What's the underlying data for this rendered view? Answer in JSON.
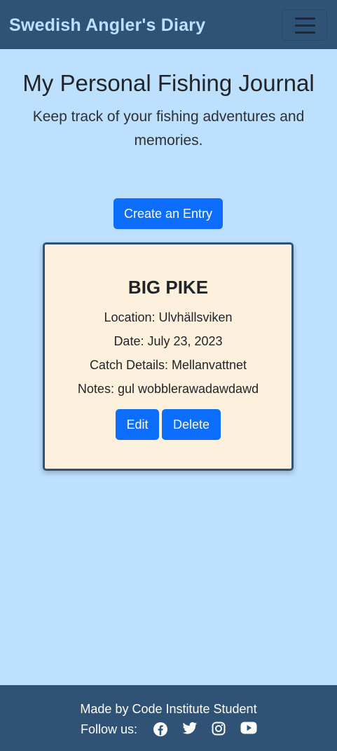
{
  "navbar": {
    "brand": "Swedish Angler's Diary",
    "toggler_icon": "hamburger-menu-icon"
  },
  "header": {
    "title": "My Personal Fishing Journal",
    "subtitle": "Keep track of your fishing adventures and memories."
  },
  "actions": {
    "create_label": "Create an Entry"
  },
  "entries": [
    {
      "title": "BIG PIKE",
      "location": "Location: Ulvhällsviken",
      "date": "Date: July 23, 2023",
      "catch_details": "Catch Details: Mellanvattnet",
      "notes": "Notes: gul wobblerawadawdawd",
      "edit_label": "Edit",
      "delete_label": "Delete"
    }
  ],
  "footer": {
    "credit": "Made by Code Institute Student",
    "follow_label": "Follow us:",
    "social_icons": [
      "facebook-icon",
      "twitter-icon",
      "instagram-icon",
      "youtube-icon"
    ]
  },
  "colors": {
    "navbar_bg": "#2f5275",
    "page_bg": "#bde0fe",
    "brand_text": "#bde0fe",
    "button_primary": "#0d6efd",
    "card_bg": "#fdf0dc"
  }
}
